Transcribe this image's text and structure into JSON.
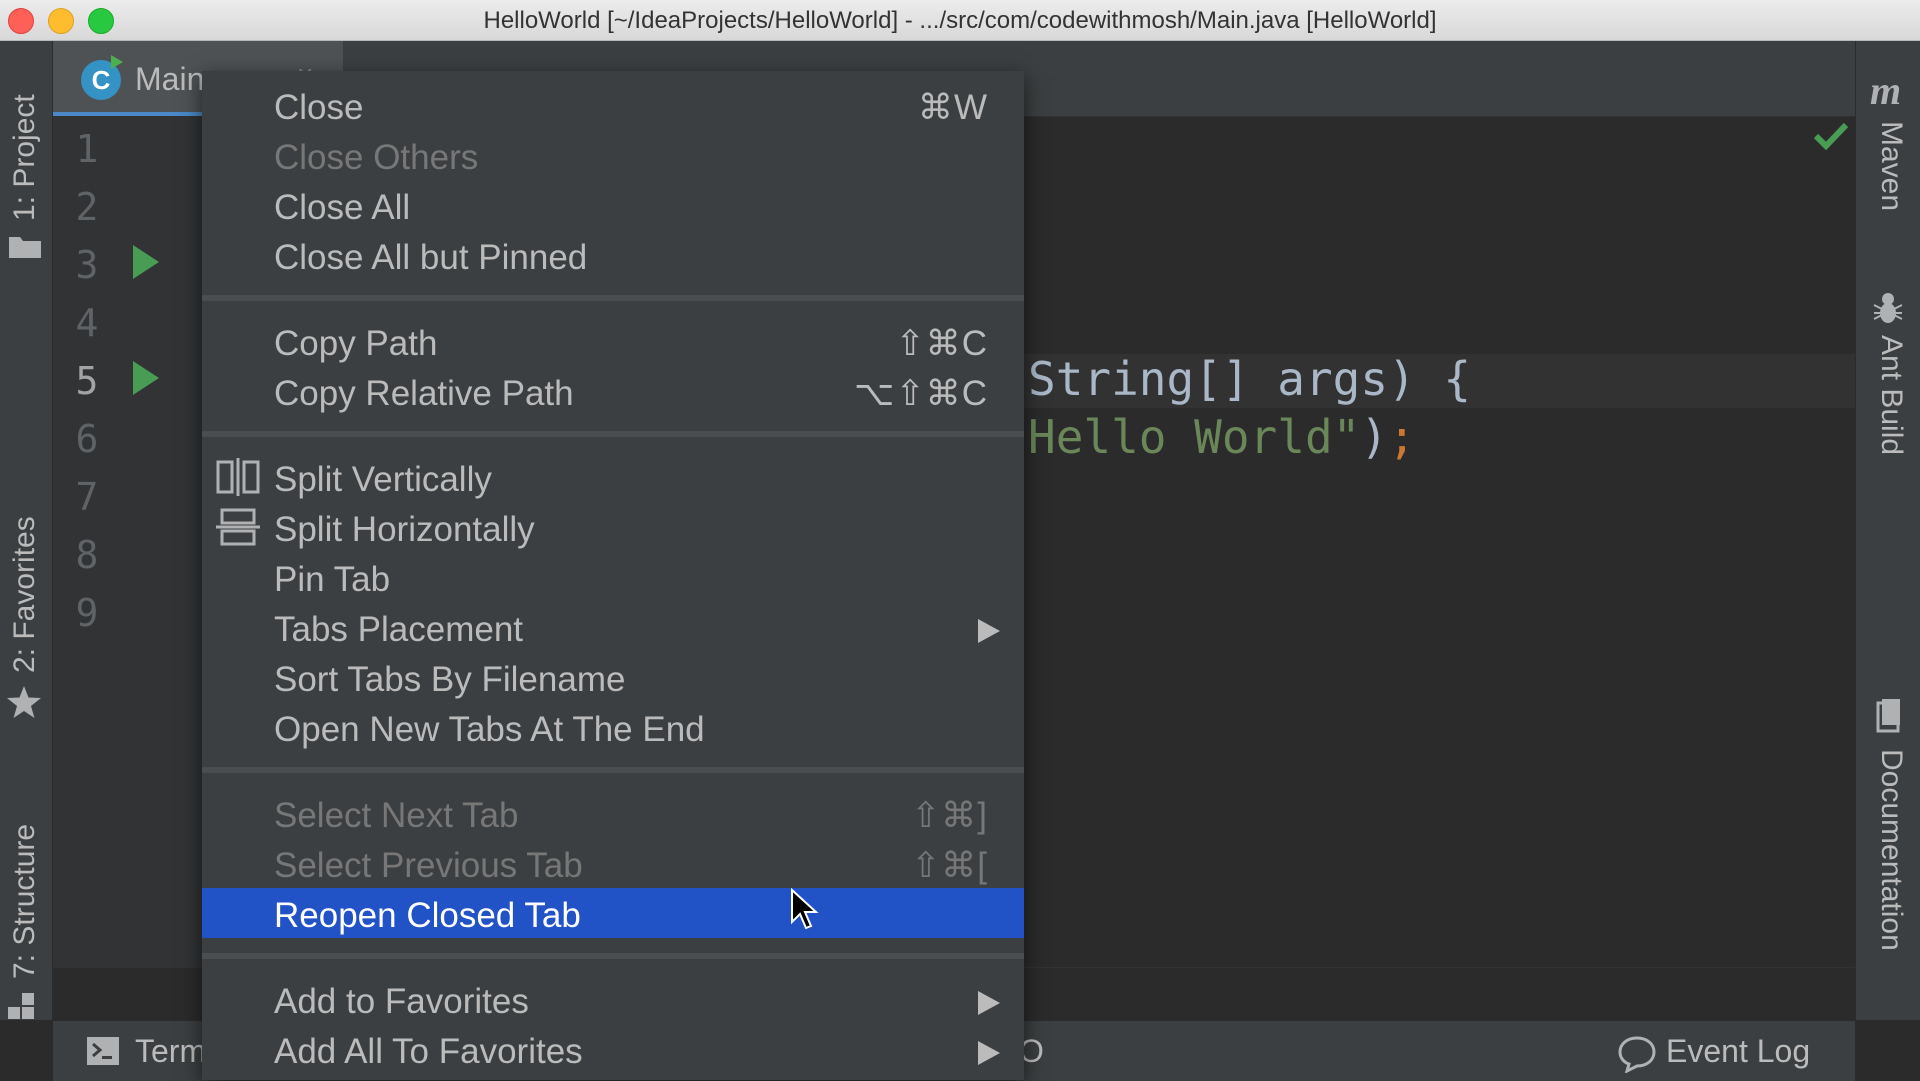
{
  "window": {
    "title": "HelloWorld [~/IdeaProjects/HelloWorld] - .../src/com/codewithmosh/Main.java [HelloWorld]"
  },
  "left_toolwindows": {
    "project": "1: Project",
    "favorites": "2: Favorites",
    "structure": "7: Structure"
  },
  "right_toolwindows": {
    "maven": "Maven",
    "ant_build": "Ant Build",
    "documentation": "Documentation",
    "maven_logo": "m"
  },
  "editor_tab": {
    "icon_letter": "C",
    "label": "Main",
    "close_glyph": "×"
  },
  "gutter": {
    "lines": [
      "1",
      "2",
      "3",
      "4",
      "5",
      "6",
      "7",
      "8",
      "9"
    ],
    "current_line": "5"
  },
  "code": {
    "line5": "String[] args) {",
    "line6_string": "Hello World\"",
    "line6_paren": ")",
    "line6_semi": ";"
  },
  "bottom_bar": {
    "terminal": "Term",
    "hidden_char": "O",
    "event_log": "Event Log"
  },
  "context_menu": {
    "group1": [
      {
        "label": "Close",
        "shortcut": "⌘W",
        "disabled": false
      },
      {
        "label": "Close Others",
        "shortcut": "",
        "disabled": true
      },
      {
        "label": "Close All",
        "shortcut": "",
        "disabled": false
      },
      {
        "label": "Close All but Pinned",
        "shortcut": "",
        "disabled": false
      }
    ],
    "group2": [
      {
        "label": "Copy Path",
        "shortcut": "⇧⌘C"
      },
      {
        "label": "Copy Relative Path",
        "shortcut": "⌥⇧⌘C"
      }
    ],
    "group3": [
      {
        "label": "Split Vertically",
        "icon": "split-vertically-icon"
      },
      {
        "label": "Split Horizontally",
        "icon": "split-horizontally-icon"
      },
      {
        "label": "Pin Tab"
      },
      {
        "label": "Tabs Placement",
        "submenu": true
      },
      {
        "label": "Sort Tabs By Filename"
      },
      {
        "label": "Open New Tabs At The End"
      }
    ],
    "group4": [
      {
        "label": "Select Next Tab",
        "shortcut": "⇧⌘]",
        "disabled": true
      },
      {
        "label": "Select Previous Tab",
        "shortcut": "⇧⌘[",
        "disabled": true
      },
      {
        "label": "Reopen Closed Tab",
        "selected": true
      }
    ],
    "group5": [
      {
        "label": "Add to Favorites",
        "submenu": true
      },
      {
        "label": "Add All To Favorites",
        "submenu": true
      }
    ]
  },
  "colors": {
    "selection": "#2152c6",
    "background": "#2b2b2b",
    "panel": "#3c3f41",
    "string": "#6a8759",
    "keyword": "#cc7832",
    "run": "#499c54"
  }
}
